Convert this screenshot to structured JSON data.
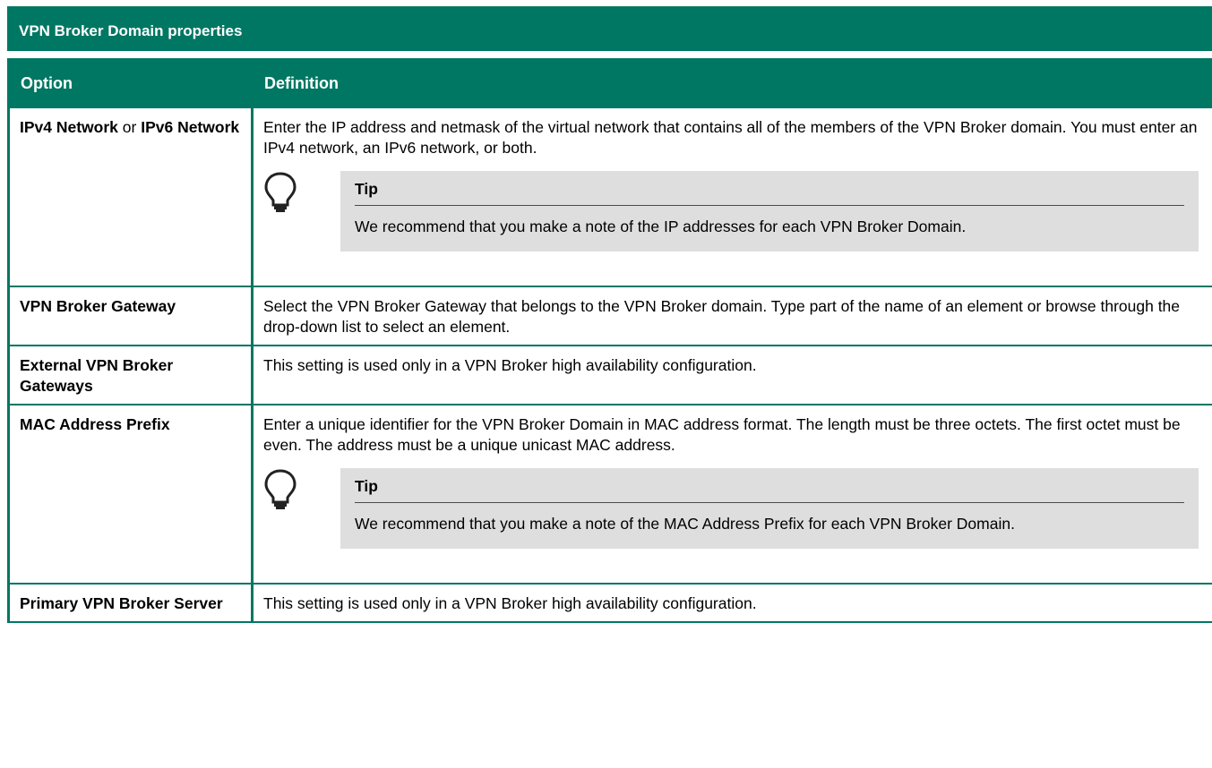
{
  "caption": "VPN Broker Domain properties",
  "headers": {
    "option": "Option",
    "definition": "Definition"
  },
  "rows": [
    {
      "option_a": "IPv4 Network",
      "option_or": " or ",
      "option_b": "IPv6 Network",
      "definition": "Enter the IP address and netmask of the virtual network that contains all of the members of the VPN Broker domain. You must enter an IPv4 network, an IPv6 network, or both.",
      "tip_title": "Tip",
      "tip_text": "We recommend that you make a note of the IP addresses for each VPN Broker Domain.",
      "tip_icon": "lightbulb-icon"
    },
    {
      "option": "VPN Broker Gateway",
      "definition": "Select the VPN Broker Gateway that belongs to the VPN Broker domain. Type part of the name of an element or browse through the drop-down list to select an element."
    },
    {
      "option": "External VPN Broker Gateways",
      "definition": "This setting is used only in a VPN Broker high availability configuration."
    },
    {
      "option": "MAC Address Prefix",
      "definition": "Enter a unique identifier for the VPN Broker Domain in MAC address format. The length must be three octets. The first octet must be even. The address must be a unique unicast MAC address.",
      "tip_title": "Tip",
      "tip_text": "We recommend that you make a note of the MAC Address Prefix for each VPN Broker Domain.",
      "tip_icon": "lightbulb-icon"
    },
    {
      "option": "Primary VPN Broker Server",
      "definition": "This setting is used only in a VPN Broker high availability configuration."
    }
  ],
  "colors": {
    "header_bg": "#007763",
    "tip_bg": "#dedede",
    "text": "#000000"
  }
}
